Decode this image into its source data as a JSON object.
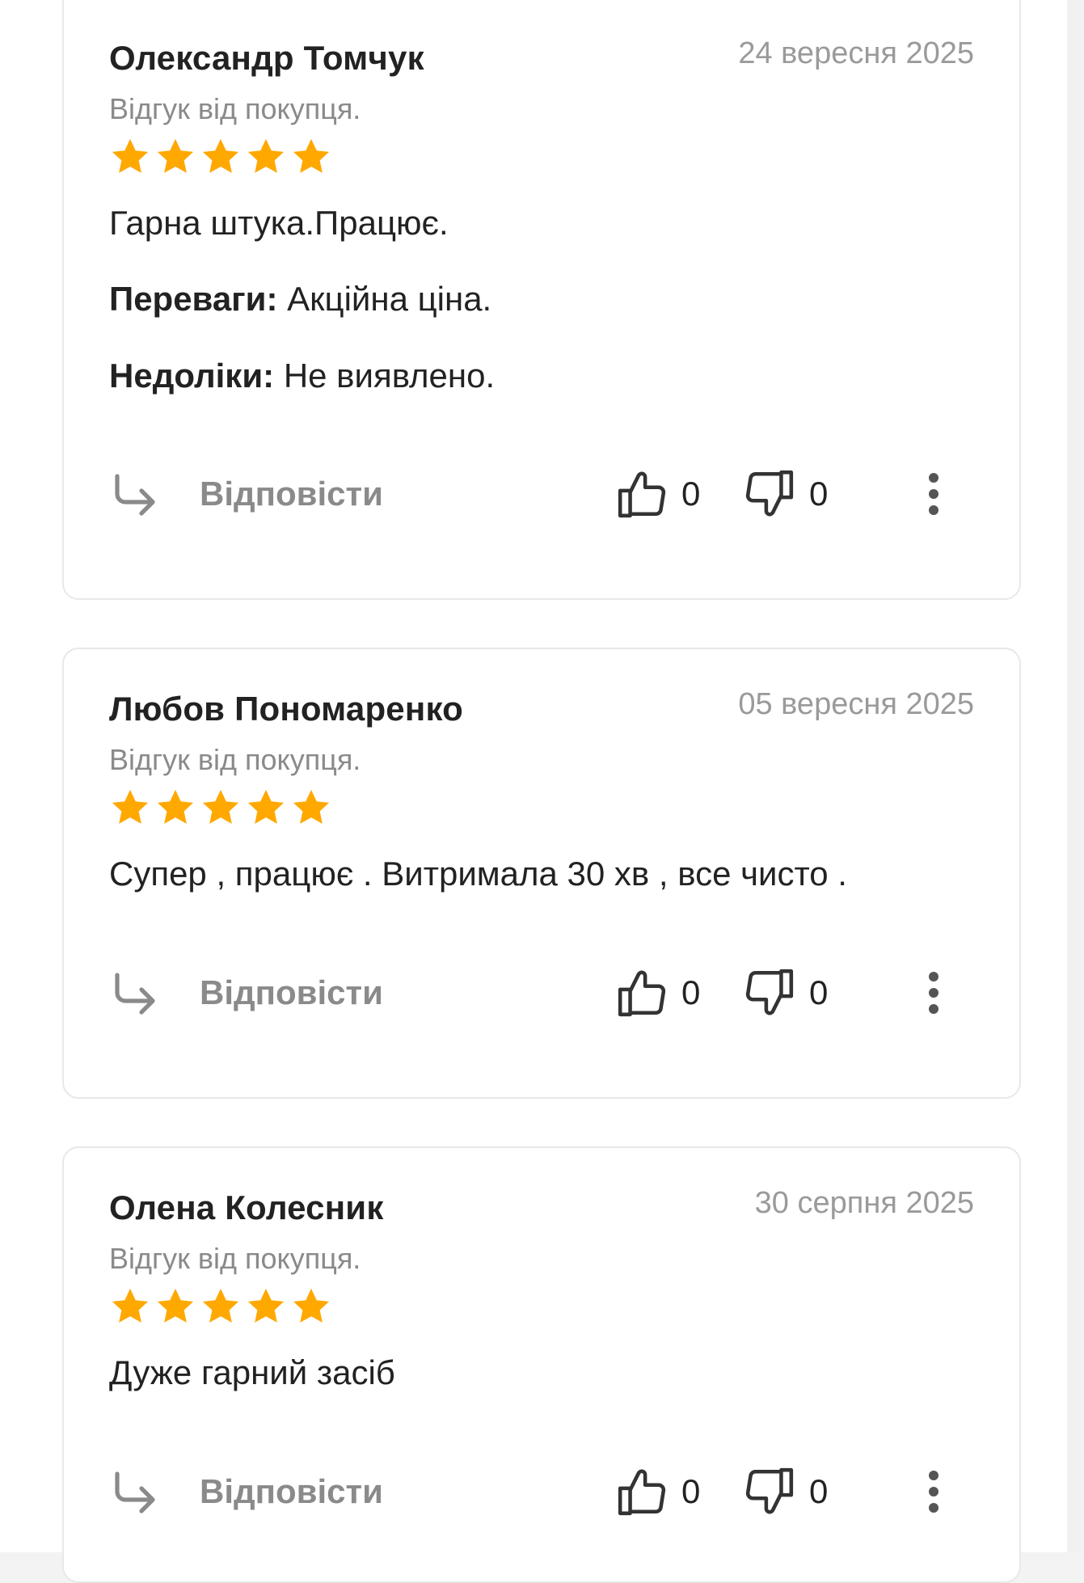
{
  "reviews": [
    {
      "author": "Олександр Томчук",
      "date": "24 вересня 2025",
      "source": "Відгук від покупця.",
      "rating": 5,
      "text": "Гарна штука.Працює.",
      "pros_label": "Переваги:",
      "pros_text": "Акційна ціна.",
      "cons_label": "Недоліки:",
      "cons_text": "Не виявлено.",
      "reply_label": "Відповісти",
      "likes": "0",
      "dislikes": "0"
    },
    {
      "author": "Любов Пономаренко",
      "date": "05 вересня 2025",
      "source": "Відгук від покупця.",
      "rating": 5,
      "text": "Супер , працює . Витримала 30 хв , все чисто .",
      "reply_label": "Відповісти",
      "likes": "0",
      "dislikes": "0"
    },
    {
      "author": "Олена Колесник",
      "date": "30 серпня 2025",
      "source": "Відгук від покупця.",
      "rating": 5,
      "text": "Дуже гарний засіб",
      "reply_label": "Відповісти",
      "likes": "0",
      "dislikes": "0"
    }
  ],
  "icons": {
    "star": "star-icon",
    "reply": "reply-arrow-icon",
    "like": "thumbs-up-icon",
    "dislike": "thumbs-down-icon",
    "more": "more-vertical-icon"
  },
  "colors": {
    "star": "#FFA800",
    "author": "#222222",
    "muted": "#8A8A8A",
    "date": "#9A9A9A",
    "card_border": "#E8E8E8"
  }
}
